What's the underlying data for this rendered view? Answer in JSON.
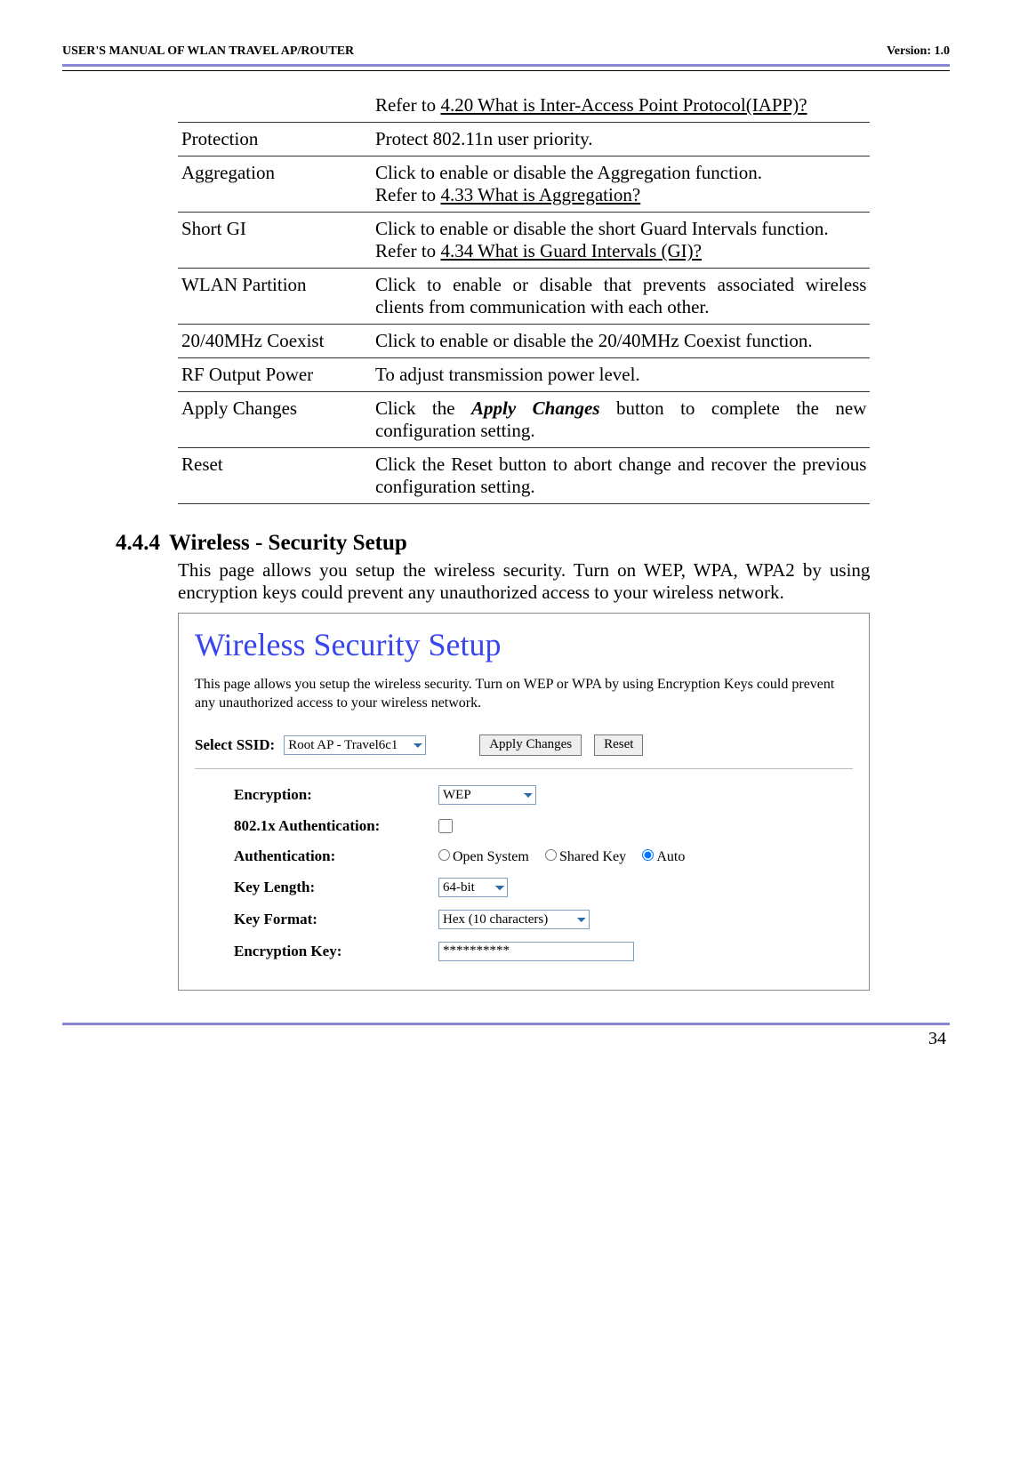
{
  "header": {
    "left": "USER'S MANUAL OF WLAN TRAVEL AP/ROUTER",
    "right": "Version: 1.0"
  },
  "defs": [
    {
      "term": "",
      "desc_pre": "Refer to ",
      "link": "4.20 What is Inter-Access Point Protocol(IAPP)?",
      "desc_post": ""
    },
    {
      "term": "Protection",
      "desc": "Protect 802.11n user priority."
    },
    {
      "term": "Aggregation",
      "desc_line1": "Click to enable or disable the Aggregation function.",
      "desc_pre": "Refer to ",
      "link": "4.33 What is Aggregation?",
      "desc_post": ""
    },
    {
      "term": "Short GI",
      "desc_line1_justify": "Click to enable or disable the short Guard Intervals function.",
      "desc_pre": "Refer to ",
      "link": "4.34 What is Guard Intervals (GI)?",
      "desc_post": ""
    },
    {
      "term": "WLAN Partition",
      "desc_justify": "Click to enable or disable that prevents associated wireless clients from communication with each other."
    },
    {
      "term": "20/40MHz Coexist",
      "desc_justify": "Click to enable or disable the 20/40MHz Coexist function."
    },
    {
      "term": "RF Output Power",
      "desc": "To adjust transmission power level."
    },
    {
      "term": "Apply Changes",
      "desc_html": "Click the <b><i>Apply Changes</i></b> button to complete the new configuration setting.",
      "justify": true
    },
    {
      "term": "Reset",
      "desc_justify": "Click the Reset button to abort change and recover the previous configuration setting."
    }
  ],
  "section": {
    "num": "4.4.4",
    "title": "Wireless - Security Setup",
    "body": "This page allows you setup the wireless security. Turn on WEP, WPA, WPA2 by using encryption keys could prevent any unauthorized access to your wireless network."
  },
  "screenshot": {
    "title": "Wireless Security Setup",
    "intro": "This page allows you setup the wireless security. Turn on WEP or WPA by using Encryption Keys could prevent any unauthorized access to your wireless network.",
    "select_ssid_label": "Select SSID:",
    "select_ssid_value": "Root AP - Travel6c1",
    "apply_btn": "Apply Changes",
    "reset_btn": "Reset",
    "fields": {
      "encryption_label": "Encryption:",
      "encryption_value": "WEP",
      "auth8021x_label": "802.1x Authentication:",
      "auth_label": "Authentication:",
      "auth_open": "Open System",
      "auth_shared": "Shared Key",
      "auth_auto": "Auto",
      "keylen_label": "Key Length:",
      "keylen_value": "64-bit",
      "keyfmt_label": "Key Format:",
      "keyfmt_value": "Hex (10 characters)",
      "enckey_label": "Encryption Key:",
      "enckey_value": "**********"
    }
  },
  "page_number": "34"
}
